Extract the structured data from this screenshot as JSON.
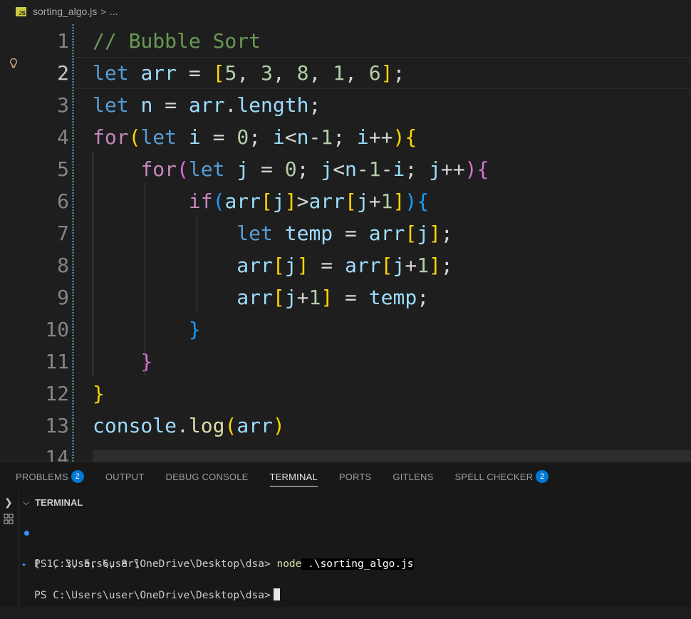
{
  "breadcrumb": {
    "file_badge": "JS",
    "file_name": "sorting_algo.js",
    "separator": ">",
    "more": "..."
  },
  "editor": {
    "lines": [
      {
        "n": "1",
        "active": false
      },
      {
        "n": "2",
        "active": true
      },
      {
        "n": "3",
        "active": false
      },
      {
        "n": "4",
        "active": false
      },
      {
        "n": "5",
        "active": false
      },
      {
        "n": "6",
        "active": false
      },
      {
        "n": "7",
        "active": false
      },
      {
        "n": "8",
        "active": false
      },
      {
        "n": "9",
        "active": false
      },
      {
        "n": "10",
        "active": false
      },
      {
        "n": "11",
        "active": false
      },
      {
        "n": "12",
        "active": false
      },
      {
        "n": "13",
        "active": false
      },
      {
        "n": "14",
        "active": false
      }
    ],
    "code": [
      [
        [
          "cm",
          "// Bubble Sort"
        ]
      ],
      [
        [
          "kw",
          "let"
        ],
        [
          "op",
          " "
        ],
        [
          "v",
          "arr"
        ],
        [
          "op",
          " = "
        ],
        [
          "b1",
          "["
        ],
        [
          "n",
          "5"
        ],
        [
          "op",
          ", "
        ],
        [
          "n",
          "3"
        ],
        [
          "op",
          ", "
        ],
        [
          "n",
          "8"
        ],
        [
          "op",
          ", "
        ],
        [
          "n",
          "1"
        ],
        [
          "op",
          ", "
        ],
        [
          "n",
          "6"
        ],
        [
          "b1",
          "]"
        ],
        [
          "op",
          ";"
        ]
      ],
      [
        [
          "kw",
          "let"
        ],
        [
          "op",
          " "
        ],
        [
          "v",
          "n"
        ],
        [
          "op",
          " = "
        ],
        [
          "v",
          "arr"
        ],
        [
          "op",
          "."
        ],
        [
          "v",
          "length"
        ],
        [
          "op",
          ";"
        ]
      ],
      [
        [
          "ctl",
          "for"
        ],
        [
          "b1",
          "("
        ],
        [
          "kw",
          "let"
        ],
        [
          "op",
          " "
        ],
        [
          "v",
          "i"
        ],
        [
          "op",
          " = "
        ],
        [
          "n",
          "0"
        ],
        [
          "op",
          "; "
        ],
        [
          "v",
          "i"
        ],
        [
          "op",
          "<"
        ],
        [
          "v",
          "n"
        ],
        [
          "op",
          "-"
        ],
        [
          "n",
          "1"
        ],
        [
          "op",
          "; "
        ],
        [
          "v",
          "i"
        ],
        [
          "op",
          "++"
        ],
        [
          "b1",
          ")"
        ],
        [
          "b1",
          "{"
        ]
      ],
      [
        [
          "op",
          "    "
        ],
        [
          "ctl",
          "for"
        ],
        [
          "b2",
          "("
        ],
        [
          "kw",
          "let"
        ],
        [
          "op",
          " "
        ],
        [
          "v",
          "j"
        ],
        [
          "op",
          " = "
        ],
        [
          "n",
          "0"
        ],
        [
          "op",
          "; "
        ],
        [
          "v",
          "j"
        ],
        [
          "op",
          "<"
        ],
        [
          "v",
          "n"
        ],
        [
          "op",
          "-"
        ],
        [
          "n",
          "1"
        ],
        [
          "op",
          "-"
        ],
        [
          "v",
          "i"
        ],
        [
          "op",
          "; "
        ],
        [
          "v",
          "j"
        ],
        [
          "op",
          "++"
        ],
        [
          "b2",
          ")"
        ],
        [
          "b2",
          "{"
        ]
      ],
      [
        [
          "op",
          "        "
        ],
        [
          "ctl",
          "if"
        ],
        [
          "b3",
          "("
        ],
        [
          "v",
          "arr"
        ],
        [
          "b1",
          "["
        ],
        [
          "v",
          "j"
        ],
        [
          "b1",
          "]"
        ],
        [
          "op",
          ">"
        ],
        [
          "v",
          "arr"
        ],
        [
          "b1",
          "["
        ],
        [
          "v",
          "j"
        ],
        [
          "op",
          "+"
        ],
        [
          "n",
          "1"
        ],
        [
          "b1",
          "]"
        ],
        [
          "b3",
          ")"
        ],
        [
          "b3",
          "{"
        ]
      ],
      [
        [
          "op",
          "            "
        ],
        [
          "kw",
          "let"
        ],
        [
          "op",
          " "
        ],
        [
          "v",
          "temp"
        ],
        [
          "op",
          " = "
        ],
        [
          "v",
          "arr"
        ],
        [
          "b1",
          "["
        ],
        [
          "v",
          "j"
        ],
        [
          "b1",
          "]"
        ],
        [
          "op",
          ";"
        ]
      ],
      [
        [
          "op",
          "            "
        ],
        [
          "v",
          "arr"
        ],
        [
          "b1",
          "["
        ],
        [
          "v",
          "j"
        ],
        [
          "b1",
          "]"
        ],
        [
          "op",
          " = "
        ],
        [
          "v",
          "arr"
        ],
        [
          "b1",
          "["
        ],
        [
          "v",
          "j"
        ],
        [
          "op",
          "+"
        ],
        [
          "n",
          "1"
        ],
        [
          "b1",
          "]"
        ],
        [
          "op",
          ";"
        ]
      ],
      [
        [
          "op",
          "            "
        ],
        [
          "v",
          "arr"
        ],
        [
          "b1",
          "["
        ],
        [
          "v",
          "j"
        ],
        [
          "op",
          "+"
        ],
        [
          "n",
          "1"
        ],
        [
          "b1",
          "]"
        ],
        [
          "op",
          " = "
        ],
        [
          "v",
          "temp"
        ],
        [
          "op",
          ";"
        ]
      ],
      [
        [
          "op",
          "        "
        ],
        [
          "b3",
          "}"
        ]
      ],
      [
        [
          "op",
          "    "
        ],
        [
          "b2",
          "}"
        ]
      ],
      [
        [
          "b1",
          "}"
        ]
      ],
      [
        [
          "v",
          "console"
        ],
        [
          "op",
          "."
        ],
        [
          "fn",
          "log"
        ],
        [
          "b1",
          "("
        ],
        [
          "v",
          "arr"
        ],
        [
          "b1",
          ")"
        ]
      ],
      []
    ]
  },
  "panel": {
    "tabs": [
      {
        "label": "PROBLEMS",
        "badge": "2",
        "active": false
      },
      {
        "label": "OUTPUT",
        "badge": null,
        "active": false
      },
      {
        "label": "DEBUG CONSOLE",
        "badge": null,
        "active": false
      },
      {
        "label": "TERMINAL",
        "badge": null,
        "active": true
      },
      {
        "label": "PORTS",
        "badge": null,
        "active": false
      },
      {
        "label": "GITLENS",
        "badge": null,
        "active": false
      },
      {
        "label": "SPELL CHECKER",
        "badge": "2",
        "active": false
      }
    ],
    "terminal_title": "TERMINAL",
    "prompt": "PS C:\\Users\\user\\OneDrive\\Desktop\\dsa>",
    "command_node": "node",
    "command_arg": " .\\sorting_algo.js",
    "output": "[ 1, 3, 5, 6, 8 ]",
    "prompt2": "PS C:\\Users\\user\\OneDrive\\Desktop\\dsa>"
  },
  "colors": {
    "keyword": "#569cd6",
    "control": "#c586c0",
    "variable": "#9cdcfe",
    "function": "#dcdcaa",
    "number": "#b5cea8",
    "comment": "#6a9955",
    "bracket1": "#ffd700",
    "bracket2": "#da70d6",
    "bracket3": "#179fff",
    "badge": "#0078d4"
  },
  "icons": {
    "lightbulb": "lightbulb-icon",
    "chevron": "chevron-right-icon",
    "terminal_chevron": "chevron-down-icon",
    "dot": "command-success-dot-icon",
    "sparkle": "command-decoration-icon"
  }
}
